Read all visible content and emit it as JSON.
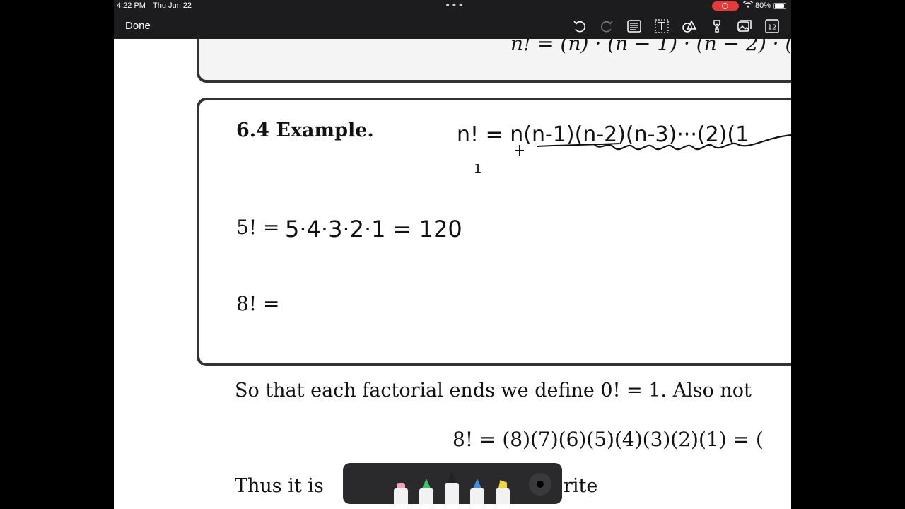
{
  "status_bar": {
    "time": "4:22 PM",
    "date": "Thu Jun 22",
    "battery": "80%",
    "battery_level": 0.8
  },
  "toolbar": {
    "done_label": "Done",
    "tools": [
      "undo-icon",
      "redo-icon",
      "page-layout-icon",
      "text-box-icon",
      "shapes-icon",
      "pen-nib-icon",
      "image-icon",
      "page-number-icon"
    ],
    "page_count": "12"
  },
  "document": {
    "prev_formula": "n! = (n) · (n − 1) · (n − 2) · (",
    "example_heading": "6.4 Example.",
    "eq_5_prefix": "5! =",
    "eq_8_prefix": "8! =",
    "paragraph_1": "So that each factorial ends we define 0! = 1.  Also not",
    "formula_8": "8! = (8)(7)(6)(5)(4)(3)(2)(1) = (",
    "paragraph_2_start": "Thus it is",
    "paragraph_2_end": "rite"
  },
  "handwriting": {
    "line_1": "n! = n(n-1)(n-2)(n-3)···(2)(1",
    "line_2": "5·4·3·2·1 = 120",
    "mark_1": "1"
  },
  "pencil_tray": {
    "tools": [
      "eraser",
      "green-pen",
      "pencil",
      "blue-marker",
      "yellow-highlighter"
    ],
    "colors": {
      "eraser": "#f2a7b6",
      "green": "#3ac46b",
      "pencil": "#222222",
      "blue": "#3e8fe0",
      "yellow": "#f5d43a"
    }
  }
}
